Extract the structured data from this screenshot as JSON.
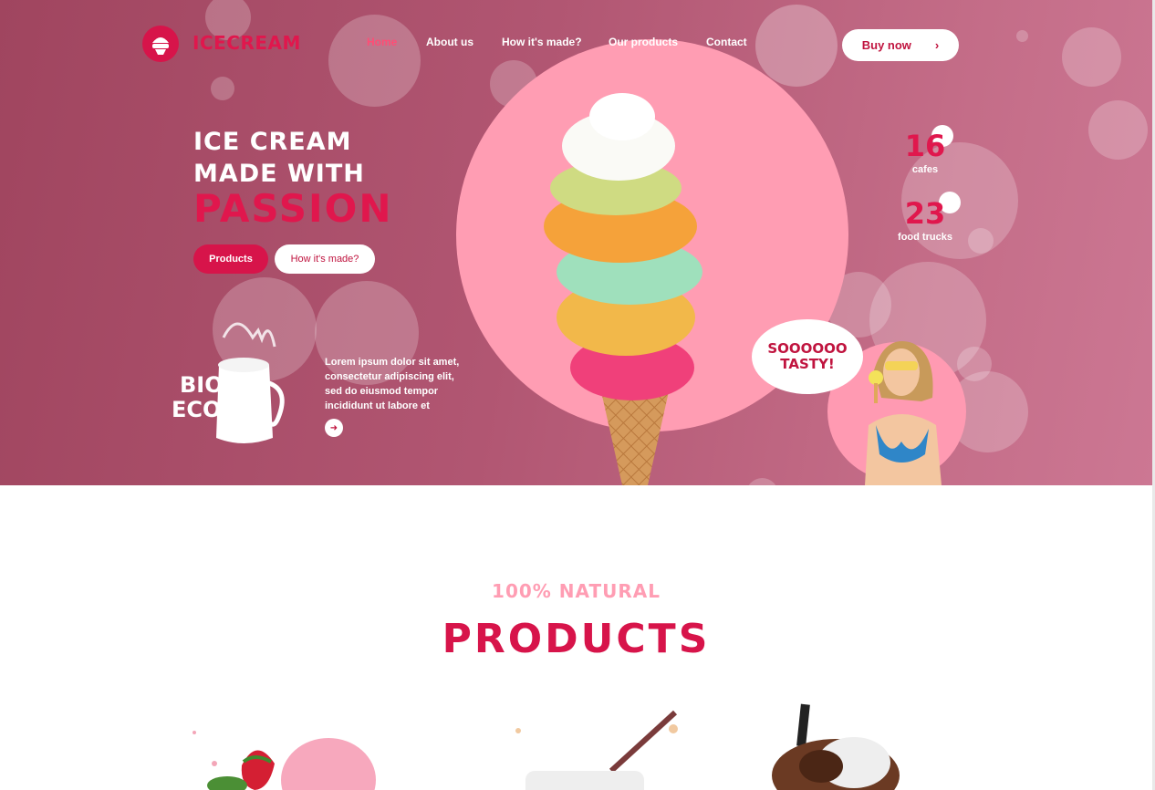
{
  "nav": {
    "brand": "ICECREAM",
    "links": [
      {
        "label": "Home",
        "active": true
      },
      {
        "label": "About us",
        "active": false
      },
      {
        "label": "How it's made?",
        "active": false
      },
      {
        "label": "Our products",
        "active": false
      },
      {
        "label": "Contact",
        "active": false
      }
    ],
    "buy_label": "Buy now",
    "buy_icon": "chevron-right-icon"
  },
  "hero": {
    "headline_line1": "ICE CREAM",
    "headline_line2": "MADE WITH",
    "headline_line3": "PASSION",
    "primary_button": "Products",
    "secondary_button": "How it's made?",
    "bio_line1": "BIO",
    "bio_line2": "ECO",
    "lorem": "Lorem ipsum dolor sit amet, consectetur adipiscing elit, sed do eiusmod tempor incididunt ut labore et",
    "arrow_icon": "arrow-right-icon",
    "speech_line1": "SOOOOOO",
    "speech_line2": "TASTY!"
  },
  "stats": [
    {
      "value": "16",
      "label": "cafes"
    },
    {
      "value": "23",
      "label": "food trucks"
    }
  ],
  "products_section": {
    "kicker": "100% NATURAL",
    "title": "PRODUCTS"
  },
  "colors": {
    "accent": "#d7144a",
    "pink": "#ff9db3",
    "hero_start": "#a0455f",
    "hero_end": "#cc7793"
  }
}
